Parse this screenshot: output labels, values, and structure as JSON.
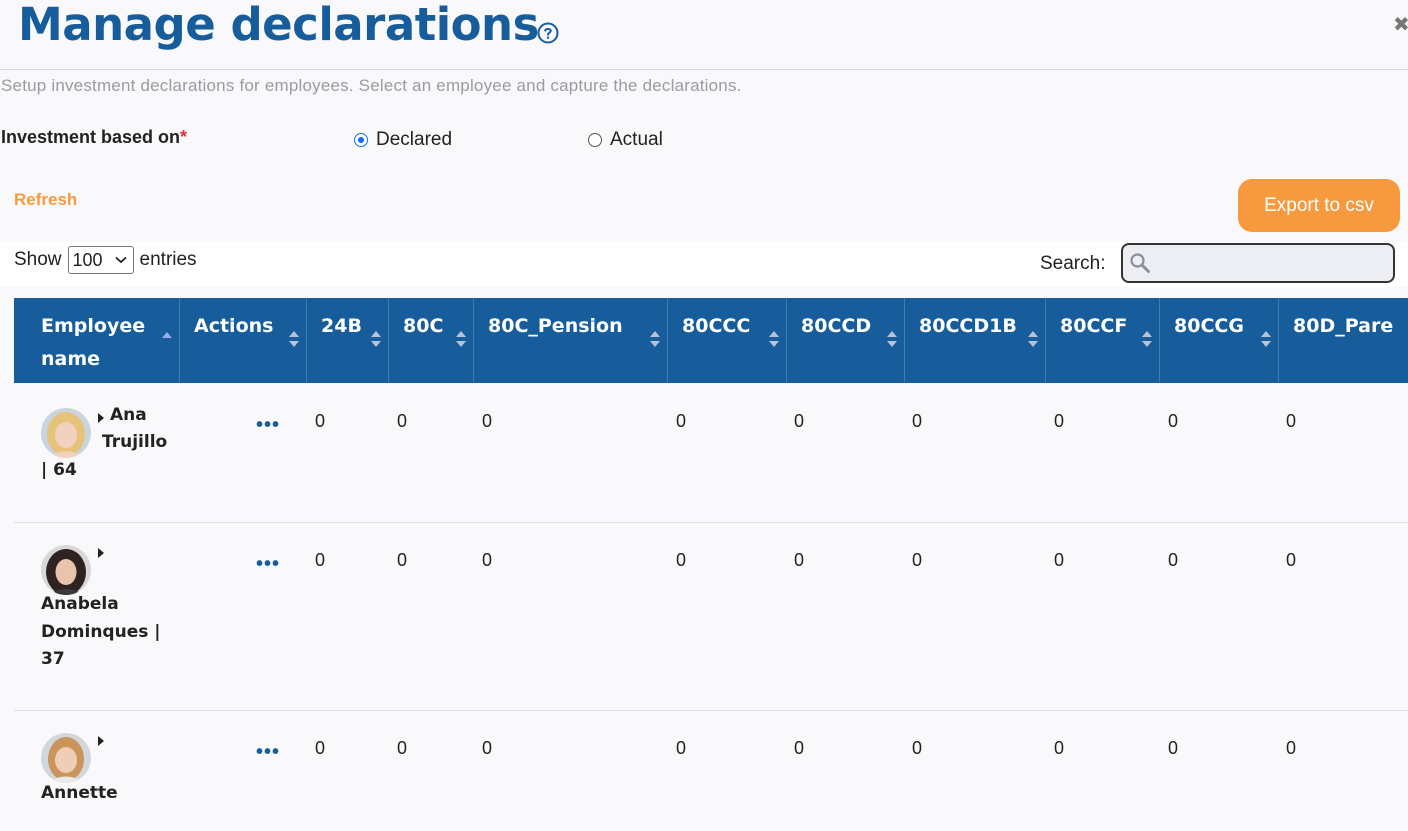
{
  "page": {
    "title": "Manage declarations",
    "subtitle": "Setup investment declarations for employees. Select an employee and capture the declarations.",
    "investment_label": "Investment based on",
    "required_mark": "*",
    "options": [
      {
        "label": "Declared",
        "selected": true
      },
      {
        "label": "Actual",
        "selected": false
      }
    ],
    "refresh_label": "Refresh",
    "export_label": "Export to csv"
  },
  "table_controls": {
    "show_label": "Show",
    "entries_value": "100",
    "entries_label": "entries",
    "search_label": "Search:",
    "search_value": ""
  },
  "columns": [
    "Employee",
    "name",
    "Actions",
    "24B",
    "80C",
    "80C_Pension",
    "80CCC",
    "80CCD",
    "80CCD1B",
    "80CCF",
    "80CCG",
    "80D_Pare"
  ],
  "rows": [
    {
      "line1": "Ana",
      "line2": "Trujillo",
      "line3": "| 64",
      "values": [
        "0",
        "0",
        "0",
        "0",
        "0",
        "0",
        "0",
        "0",
        "0"
      ]
    },
    {
      "line1": "Anabela",
      "line2": "Dominques |",
      "line3": "37",
      "values": [
        "0",
        "0",
        "0",
        "0",
        "0",
        "0",
        "0",
        "0",
        "0"
      ]
    },
    {
      "line1": "Annette",
      "line2": "",
      "line3": "",
      "values": [
        "0",
        "0",
        "0",
        "0",
        "0",
        "0",
        "0",
        "0",
        "0"
      ]
    }
  ],
  "actions_glyph": "•••",
  "colors": {
    "brand_blue": "#175d9c",
    "accent_orange": "#f79a3e",
    "required_red": "#e03030"
  }
}
